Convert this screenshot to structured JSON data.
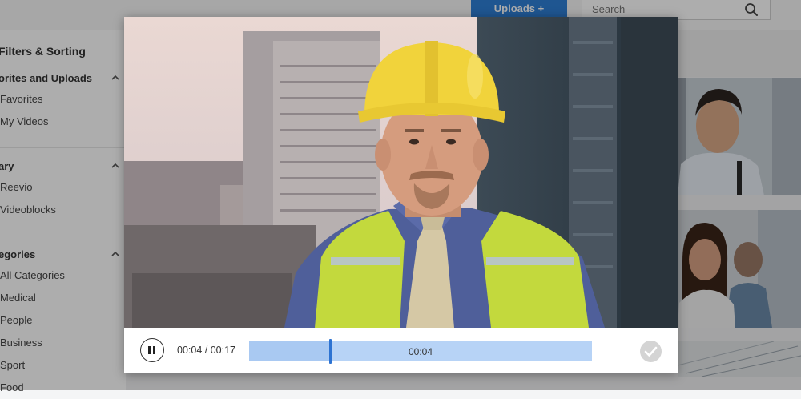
{
  "header": {
    "uploads_label": "Uploads +",
    "search_placeholder": "Search"
  },
  "sidebar": {
    "title": "Filters & Sorting",
    "sections": [
      {
        "label": "orites and Uploads",
        "items": [
          "Favorites",
          "My Videos"
        ]
      },
      {
        "label": "ary",
        "items": [
          "Reevio",
          "Videoblocks"
        ]
      },
      {
        "label": "egories",
        "items": [
          "All Categories",
          "Medical",
          "People",
          "Business",
          "Sport",
          "Food"
        ]
      }
    ]
  },
  "player": {
    "elapsed": "00:04",
    "duration": "00:17",
    "time_readout": "00:04 / 00:17",
    "scrub_label": "00:04",
    "progress_fraction": 0.2353
  },
  "colors": {
    "accent": "#2f7fd6",
    "timeline": "#b7d3f6",
    "playhead": "#2d73d2",
    "confirm": "#d4d4d4"
  },
  "icons": [
    "search-icon",
    "chevron-up-icon",
    "pause-icon",
    "checkmark-icon"
  ]
}
